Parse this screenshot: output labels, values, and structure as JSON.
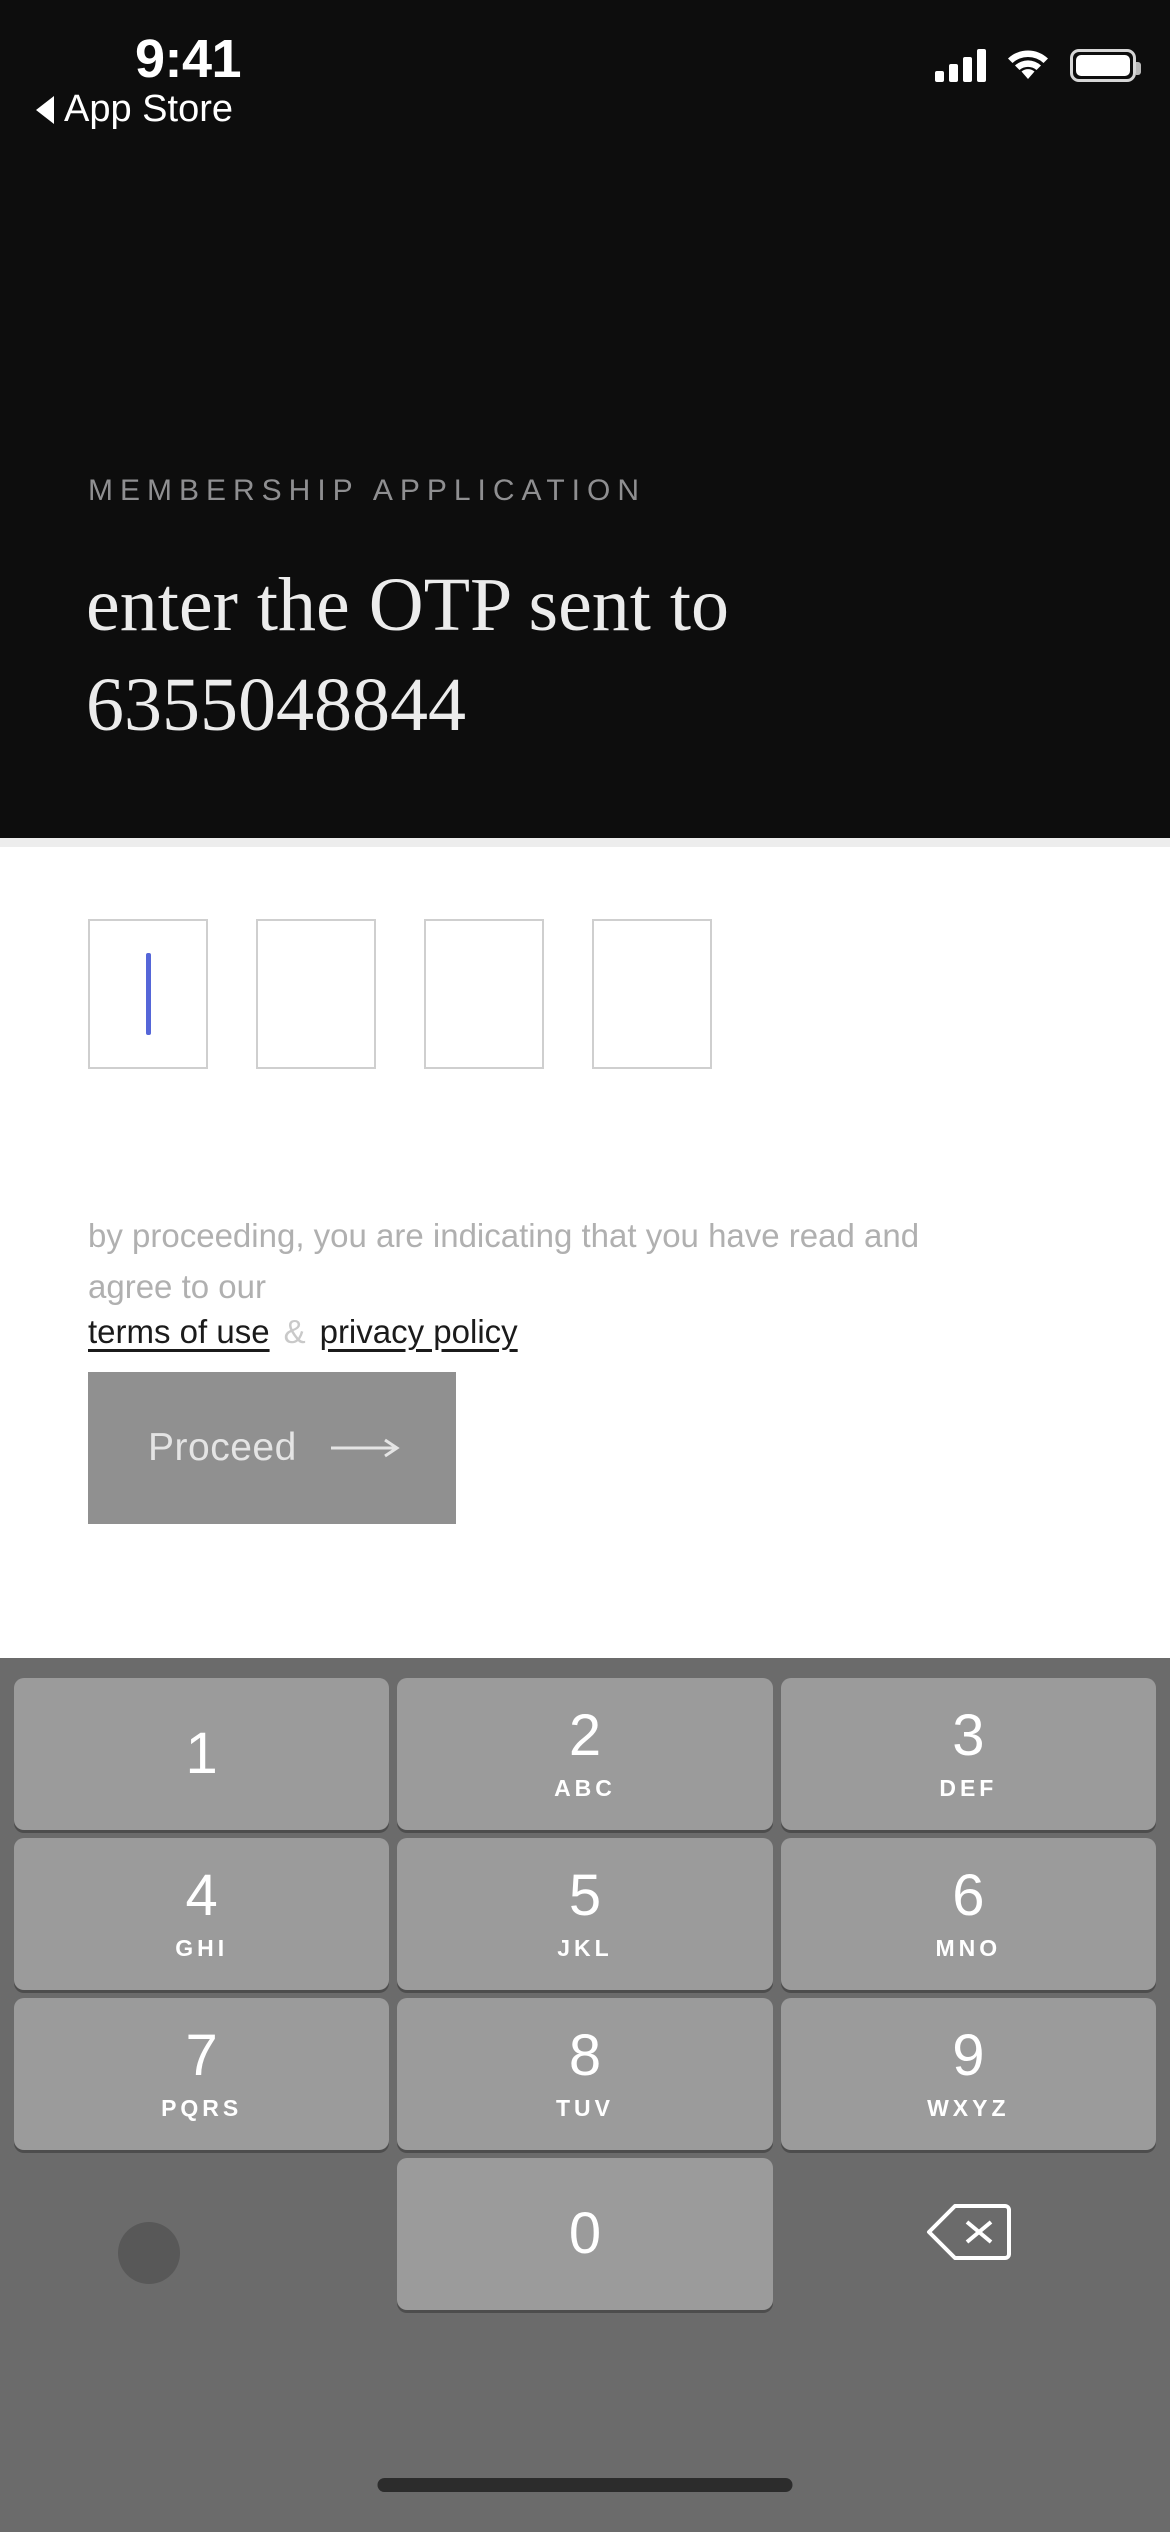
{
  "status_bar": {
    "time": "9:41",
    "back_label": "App Store",
    "back_icon": "back-caret-icon",
    "signal_icon": "cellular-signal-icon",
    "wifi_icon": "wifi-icon",
    "battery_icon": "battery-full-icon"
  },
  "header": {
    "eyebrow": "MEMBERSHIP APPLICATION",
    "headline": "enter the OTP sent to 6355048844",
    "phone_number": "6355048844",
    "background_color": "#0d0d0d",
    "text_color": "#ececec"
  },
  "otp": {
    "length": 4,
    "values": [
      "",
      "",
      "",
      ""
    ],
    "active_index": 0,
    "caret_color": "#5566d8",
    "border_color": "#cfcfcf"
  },
  "terms": {
    "text": "by proceeding, you are indicating that you have read and agree to our",
    "terms_link": "terms of use",
    "separator": "&",
    "privacy_link": "privacy policy",
    "text_color": "#b0b0b0",
    "link_color": "#1b1b1b"
  },
  "proceed_button": {
    "label": "Proceed",
    "arrow_icon": "arrow-right-icon",
    "enabled": false,
    "background_color": "#909090",
    "text_color": "#e4e4e4"
  },
  "keyboard": {
    "background_color": "#6b6b6b",
    "key_color": "#9b9b9b",
    "keys": [
      {
        "digit": "1",
        "letters": ""
      },
      {
        "digit": "2",
        "letters": "ABC"
      },
      {
        "digit": "3",
        "letters": "DEF"
      },
      {
        "digit": "4",
        "letters": "GHI"
      },
      {
        "digit": "5",
        "letters": "JKL"
      },
      {
        "digit": "6",
        "letters": "MNO"
      },
      {
        "digit": "7",
        "letters": "PQRS"
      },
      {
        "digit": "8",
        "letters": "TUV"
      },
      {
        "digit": "9",
        "letters": "WXYZ"
      },
      {
        "digit": "",
        "letters": ""
      },
      {
        "digit": "0",
        "letters": ""
      },
      {
        "digit": "",
        "letters": ""
      }
    ],
    "delete_icon": "backspace-delete-icon",
    "globe_icon": "globe-key-icon"
  }
}
